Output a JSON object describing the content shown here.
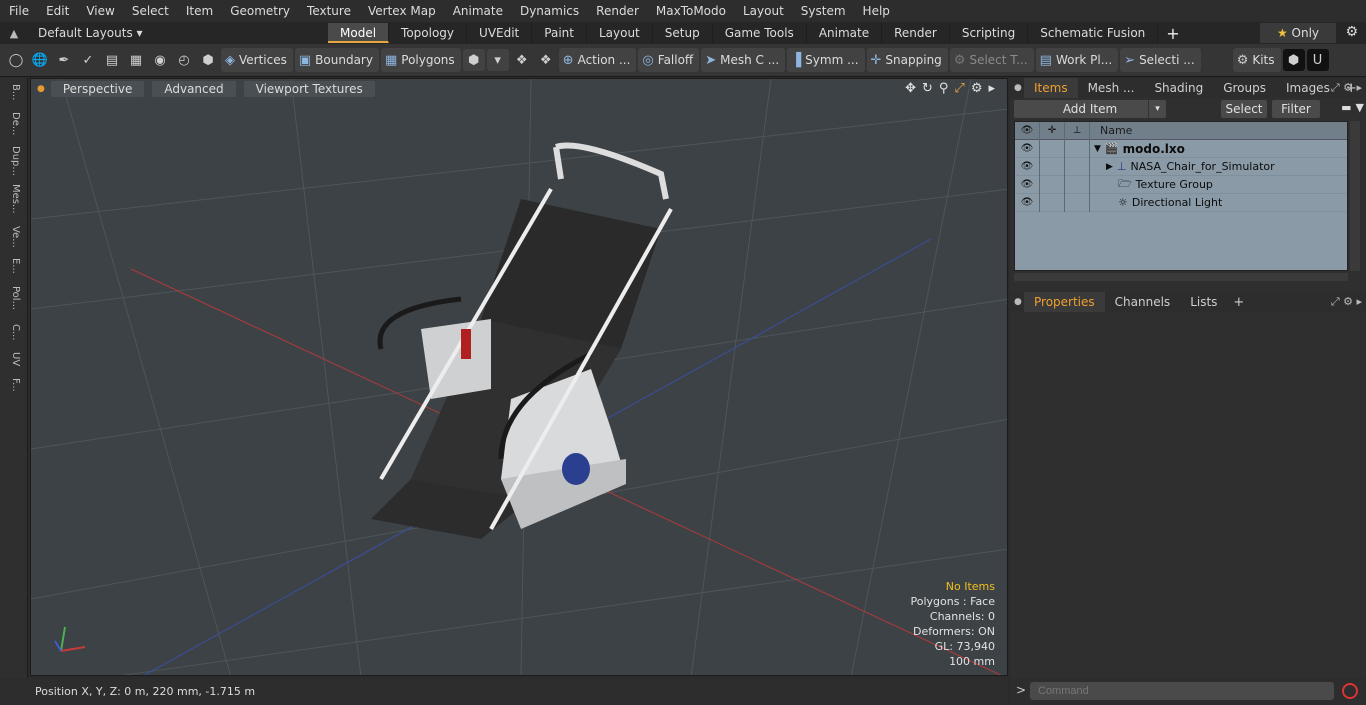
{
  "menubar": [
    "File",
    "Edit",
    "View",
    "Select",
    "Item",
    "Geometry",
    "Texture",
    "Vertex Map",
    "Animate",
    "Dynamics",
    "Render",
    "MaxToModo",
    "Layout",
    "System",
    "Help"
  ],
  "layout_selector": "Default Layouts ▾",
  "tabs": [
    "Model",
    "Topology",
    "UVEdit",
    "Paint",
    "Layout",
    "Setup",
    "Game Tools",
    "Animate",
    "Render",
    "Scripting",
    "Schematic Fusion"
  ],
  "active_tab": "Model",
  "only_label": "Only",
  "toolbar": {
    "vertices": "Vertices",
    "boundary": "Boundary",
    "polygons": "Polygons",
    "action": "Action ...",
    "falloff": "Falloff",
    "mesh": "Mesh C ...",
    "symm": "Symm ...",
    "snapping": "Snapping",
    "select_t": "Select T...",
    "work_pl": "Work Pl...",
    "selecti": "Selecti ...",
    "kits": "Kits"
  },
  "left_tabs": [
    "B...",
    "De...",
    "Dup...",
    "Mes...",
    "Ve...",
    "E...",
    "Pol...",
    "C...",
    "UV",
    "F..."
  ],
  "viewport": {
    "perspective": "Perspective",
    "advanced": "Advanced",
    "textures": "Viewport Textures",
    "info_no_items": "No Items",
    "info_polygons": "Polygons : Face",
    "info_channels": "Channels: 0",
    "info_deformers": "Deformers: ON",
    "info_gl": "GL: 73,940",
    "info_scale": "100 mm"
  },
  "status": {
    "position": "Position X, Y, Z:   0 m, 220 mm, -1.715 m"
  },
  "items_panel": {
    "tabs": [
      "Items",
      "Mesh ...",
      "Shading",
      "Groups",
      "Images"
    ],
    "active": "Items",
    "add_item": "Add Item",
    "select": "Select",
    "filter": "Filter",
    "name_header": "Name",
    "rows": [
      "modo.lxo",
      "NASA_Chair_for_Simulator",
      "Texture Group",
      "Directional Light"
    ]
  },
  "props_panel": {
    "tabs": [
      "Properties",
      "Channels",
      "Lists"
    ],
    "active": "Properties"
  },
  "command": {
    "placeholder": "Command"
  }
}
